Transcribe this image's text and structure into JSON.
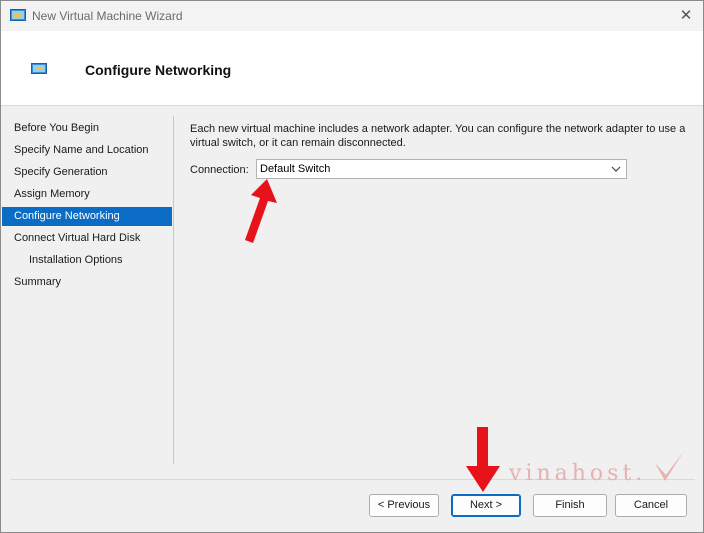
{
  "window": {
    "title": "New Virtual Machine Wizard",
    "close_symbol": "✕"
  },
  "header": {
    "title": "Configure Networking"
  },
  "sidebar": {
    "items": [
      {
        "label": "Before You Begin"
      },
      {
        "label": "Specify Name and Location"
      },
      {
        "label": "Specify Generation"
      },
      {
        "label": "Assign Memory"
      },
      {
        "label": "Configure Networking",
        "active": true
      },
      {
        "label": "Connect Virtual Hard Disk"
      },
      {
        "label": "Installation Options",
        "indent": true
      },
      {
        "label": "Summary"
      }
    ]
  },
  "main": {
    "description": "Each new virtual machine includes a network adapter. You can configure the network adapter to use a virtual switch, or it can remain disconnected.",
    "connection_label": "Connection:",
    "connection_value": "Default Switch"
  },
  "buttons": {
    "previous": "< Previous",
    "next": "Next >",
    "finish": "Finish",
    "cancel": "Cancel"
  },
  "watermark": {
    "text": "vinahost."
  },
  "colors": {
    "accent": "#0a6cc4",
    "annotation_arrow": "#e8121a"
  }
}
